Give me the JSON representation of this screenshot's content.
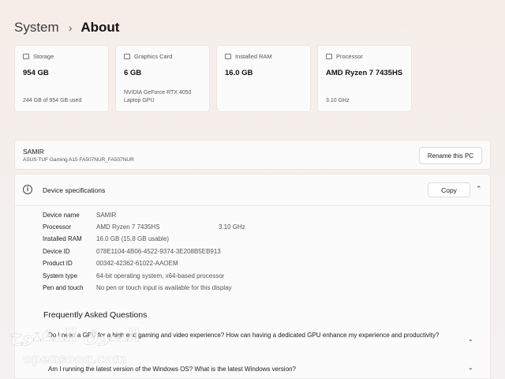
{
  "breadcrumb": {
    "parent": "System",
    "separator": "›",
    "current": "About"
  },
  "cards": [
    {
      "label": "Storage",
      "value": "954 GB",
      "sub": "244 GB of 954 GB used"
    },
    {
      "label": "Graphics Card",
      "value": "6 GB",
      "sub": "NVIDIA GeForce RTX 4050 Laptop GPU"
    },
    {
      "label": "Installed RAM",
      "value": "16.0 GB",
      "sub": ""
    },
    {
      "label": "Processor",
      "value": "AMD Ryzen 7 7435HS",
      "sub": "3.10 GHz"
    }
  ],
  "device": {
    "name": "SAMIR",
    "model": "ASUS TUF Gaming A15 FA507NUR_FA507NUR",
    "rename_label": "Rename this PC"
  },
  "specs": {
    "title": "Device specifications",
    "copy_label": "Copy",
    "info_glyph": "i",
    "collapse_glyph": "⌃",
    "rows": [
      {
        "label": "Device name",
        "value": "SAMIR",
        "extra": ""
      },
      {
        "label": "Processor",
        "value": "AMD Ryzen 7 7435HS",
        "extra": "3.10 GHz"
      },
      {
        "label": "Installed RAM",
        "value": "16.0 GB (15.8 GB usable)",
        "extra": ""
      },
      {
        "label": "Device ID",
        "value": "078E1104-4B06-4522-9374-3E208B5EB913",
        "extra": ""
      },
      {
        "label": "Product ID",
        "value": "00342-42362-61022-AAOEM",
        "extra": ""
      },
      {
        "label": "System type",
        "value": "64-bit operating system, x64-based processor",
        "extra": ""
      },
      {
        "label": "Pen and touch",
        "value": "No pen or touch input is available for this display",
        "extra": ""
      }
    ]
  },
  "faq": {
    "title": "Frequently Asked Questions",
    "chevron": "⌄",
    "items": [
      "Do I need a GPU for a high end gaming and video experience? How can having a dedicated GPU enhance my experience and productivity?",
      "Am I running the latest version of the Windows OS? What is the latest Windows version?"
    ]
  },
  "watermark": {
    "text": "السوق المفتوح",
    "sub": "opensooq.com"
  }
}
